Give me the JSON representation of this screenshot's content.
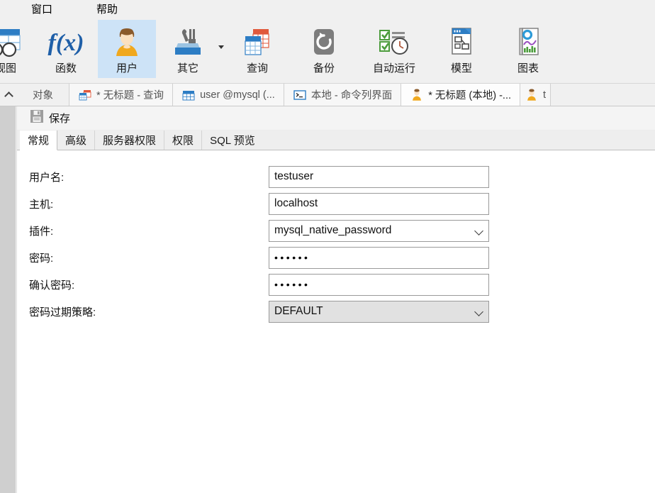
{
  "menubar": {
    "items": [
      {
        "label": "窗口",
        "name": "menu-window"
      },
      {
        "label": "帮助",
        "name": "menu-help"
      }
    ]
  },
  "ribbon": {
    "buttons": [
      {
        "label": "视图",
        "icon": "view-grid-icon",
        "active": false,
        "caret": false
      },
      {
        "label": "函数",
        "icon": "function-fx-icon",
        "active": false,
        "caret": false
      },
      {
        "label": "用户",
        "icon": "user-person-icon",
        "active": true,
        "caret": false
      },
      {
        "label": "其它",
        "icon": "other-tools-icon",
        "active": false,
        "caret": true
      },
      {
        "label": "查询",
        "icon": "query-table-icon",
        "active": false,
        "caret": false
      },
      {
        "label": "备份",
        "icon": "backup-restore-icon",
        "active": false,
        "caret": false
      },
      {
        "label": "自动运行",
        "icon": "automation-clock-icon",
        "active": false,
        "caret": false
      },
      {
        "label": "模型",
        "icon": "model-diagram-icon",
        "active": false,
        "caret": false
      },
      {
        "label": "图表",
        "icon": "chart-report-icon",
        "active": false,
        "caret": false
      }
    ]
  },
  "window_tabs": {
    "collapse_icon": "chevron-up-icon",
    "items": [
      {
        "label": "对象",
        "icon": "none",
        "style": "plain",
        "active": false
      },
      {
        "label": "* 无标题 - 查询",
        "icon": "query-table-icon",
        "style": "boxed",
        "active": false
      },
      {
        "label": "user @mysql (...",
        "icon": "table-grid-icon",
        "style": "boxed",
        "active": false
      },
      {
        "label": "本地 - 命令列界面",
        "icon": "console-terminal-icon",
        "style": "boxed",
        "active": false
      },
      {
        "label": "* 无标题 (本地) -...",
        "icon": "user-person-icon",
        "style": "boxed",
        "active": true
      },
      {
        "label": "t",
        "icon": "user-person-icon",
        "style": "boxed",
        "active": false
      }
    ]
  },
  "editor": {
    "toolbar": {
      "save_label": "保存",
      "save_icon": "floppy-save-icon"
    },
    "tabs": [
      {
        "label": "常规",
        "selected": true
      },
      {
        "label": "高级",
        "selected": false
      },
      {
        "label": "服务器权限",
        "selected": false
      },
      {
        "label": "权限",
        "selected": false
      },
      {
        "label": "SQL 预览",
        "selected": false
      }
    ],
    "fields": [
      {
        "label": "用户名:",
        "value": "testuser",
        "type": "text",
        "name": "username-field"
      },
      {
        "label": "主机:",
        "value": "localhost",
        "type": "text",
        "name": "host-field"
      },
      {
        "label": "插件:",
        "value": "mysql_native_password",
        "type": "select",
        "name": "plugin-select"
      },
      {
        "label": "密码:",
        "value": "••••••",
        "type": "password",
        "name": "password-field"
      },
      {
        "label": "确认密码:",
        "value": "••••••",
        "type": "password",
        "name": "confirm-password-field"
      },
      {
        "label": "密码过期策略:",
        "value": "DEFAULT",
        "type": "select-disabled",
        "name": "password-expiry-policy-select"
      }
    ]
  },
  "colors": {
    "ribbon_bg": "#f0f0f0",
    "active_ribbon": "#cde3f7",
    "accent_blue": "#2d7dc4",
    "user_shirt": "#f0a81e",
    "gutter": "#cfcfcf"
  }
}
